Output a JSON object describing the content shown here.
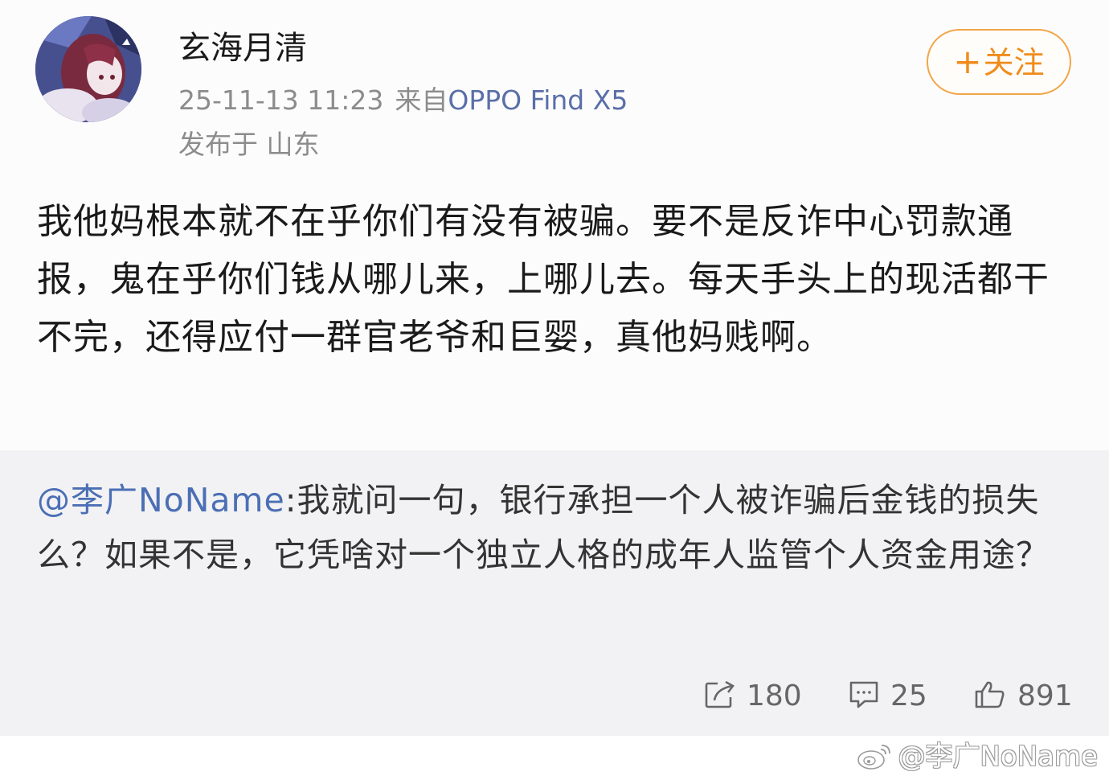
{
  "post": {
    "username": "玄海月清",
    "timestamp": "25-11-13 11:23",
    "source_prefix": "来自",
    "source_device": "OPPO Find X5",
    "location": "发布于 山东",
    "follow_label": "关注",
    "follow_plus": "+",
    "body": "我他妈根本就不在乎你们有没有被骗。要不是反诈中心罚款通报，鬼在乎你们钱从哪儿来，上哪儿去。每天手头上的现活都干不完，还得应付一群官老爷和巨婴，真他妈贱啊。"
  },
  "repost": {
    "mention": "@李广NoName",
    "text": ":我就问一句，银行承担一个人被诈骗后金钱的损失么？如果不是，它凭啥对一个独立人格的成年人监管个人资金用途？",
    "actions": {
      "share_count": "180",
      "comment_count": "25",
      "like_count": "891"
    }
  },
  "watermark": {
    "text": "@李广NoName"
  },
  "colors": {
    "accent_orange": "#f08c1c",
    "link_blue": "#4b6fb5",
    "repost_bg": "#f2f2f4"
  },
  "icons": [
    "avatar",
    "share-icon",
    "comment-icon",
    "like-icon",
    "weibo-logo-icon"
  ]
}
